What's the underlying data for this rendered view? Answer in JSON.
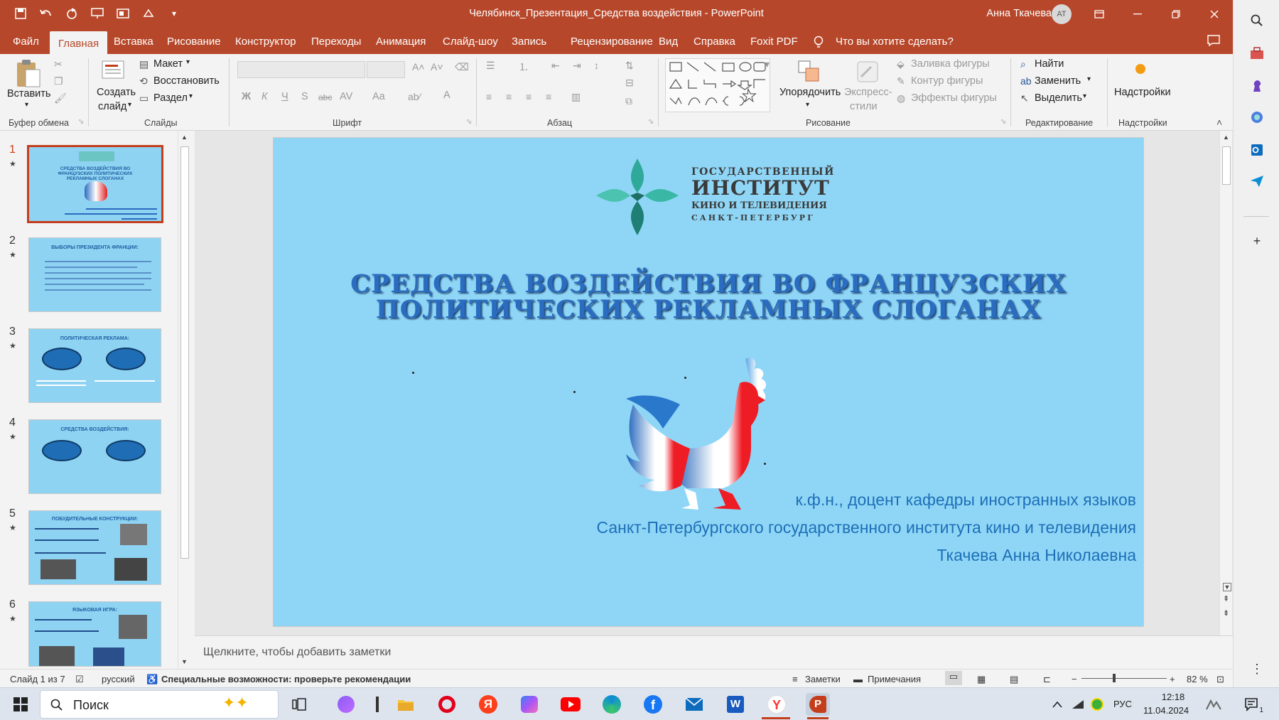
{
  "window": {
    "title": "Челябинск_Презентация_Средства воздействия - PowerPoint",
    "user_name": "Анна Ткачева",
    "user_initials": "АТ"
  },
  "menu": {
    "file": "Файл",
    "tabs": [
      "Главная",
      "Вставка",
      "Рисование",
      "Конструктор",
      "Переходы",
      "Анимация",
      "Слайд-шоу",
      "Запись",
      "Рецензирование",
      "Вид",
      "Справка",
      "Foxit PDF"
    ],
    "search_prompt": "Что вы хотите сделать?"
  },
  "ribbon": {
    "clipboard": {
      "paste": "Вставить",
      "group": "Буфер обмена"
    },
    "slides": {
      "create": "Создать",
      "create2": "слайд",
      "layout": "Макет",
      "restore": "Восстановить",
      "section": "Раздел",
      "group": "Слайды"
    },
    "font": {
      "group": "Шрифт",
      "bold": "Ж",
      "italic": "К",
      "underline": "Ч",
      "strike": "S",
      "abc": "abc",
      "av": "AV",
      "aa": "Aa",
      "a": "A"
    },
    "paragraph": {
      "group": "Абзац"
    },
    "drawing": {
      "arrange": "Упорядочить",
      "quick_styles": "Экспресс-",
      "quick_styles2": "стили",
      "fill": "Заливка фигуры",
      "outline": "Контур фигуры",
      "effects": "Эффекты фигуры",
      "group": "Рисование"
    },
    "editing": {
      "find": "Найти",
      "replace": "Заменить",
      "select": "Выделить",
      "group": "Редактирование"
    },
    "addins": {
      "label": "Надстройки",
      "group": "Надстройки"
    }
  },
  "thumbnails": [
    {
      "num": "1",
      "title": "СРЕДСТВА ВОЗДЕЙСТВИЯ ВО ФРАНЦУЗСКИХ ПОЛИТИЧЕСКИХ РЕКЛАМНЫХ СЛОГАНАХ",
      "selected": true
    },
    {
      "num": "2",
      "title": "ВЫБОРЫ ПРЕЗИДЕНТА ФРАНЦИИ:"
    },
    {
      "num": "3",
      "title": "ПОЛИТИЧЕСКАЯ РЕКЛАМА:"
    },
    {
      "num": "4",
      "title": "СРЕДСТВА ВОЗДЕЙСТВИЯ:"
    },
    {
      "num": "5",
      "title": "ПОБУДИТЕЛЬНЫЕ КОНСТРУКЦИИ:"
    },
    {
      "num": "6",
      "title": "ЯЗЫКОВАЯ ИГРА:"
    }
  ],
  "slide": {
    "logo": {
      "line1": "ГОСУДАРСТВЕННЫЙ",
      "line2": "ИНСТИТУТ",
      "line3": "КИНО И ТЕЛЕВИДЕНИЯ",
      "line4": "САНКТ-ПЕТЕРБУРГ"
    },
    "title_line1": "СРЕДСТВА ВОЗДЕЙСТВИЯ ВО ФРАНЦУЗСКИХ",
    "title_line2": "ПОЛИТИЧЕСКИХ РЕКЛАМНЫХ СЛОГАНАХ",
    "author_line1": "к.ф.н., доцент кафедры иностранных языков",
    "author_line2": "Санкт-Петербургского государственного института кино и телевидения",
    "author_line3": "Ткачева Анна Николаевна"
  },
  "notes_placeholder": "Щелкните, чтобы добавить заметки",
  "status": {
    "slide_counter": "Слайд 1 из 7",
    "language": "русский",
    "accessibility": "Специальные возможности: проверьте рекомендации",
    "notes": "Заметки",
    "comments": "Примечания",
    "zoom": "82 %"
  },
  "taskbar": {
    "search": "Поиск",
    "lang": "РУС",
    "time": "12:18",
    "date": "11.04.2024",
    "notif_count": "1"
  },
  "colors": {
    "accent": "#b7472a",
    "slide_bg": "#8fd6f6",
    "title_blue": "#2a6cc0"
  }
}
